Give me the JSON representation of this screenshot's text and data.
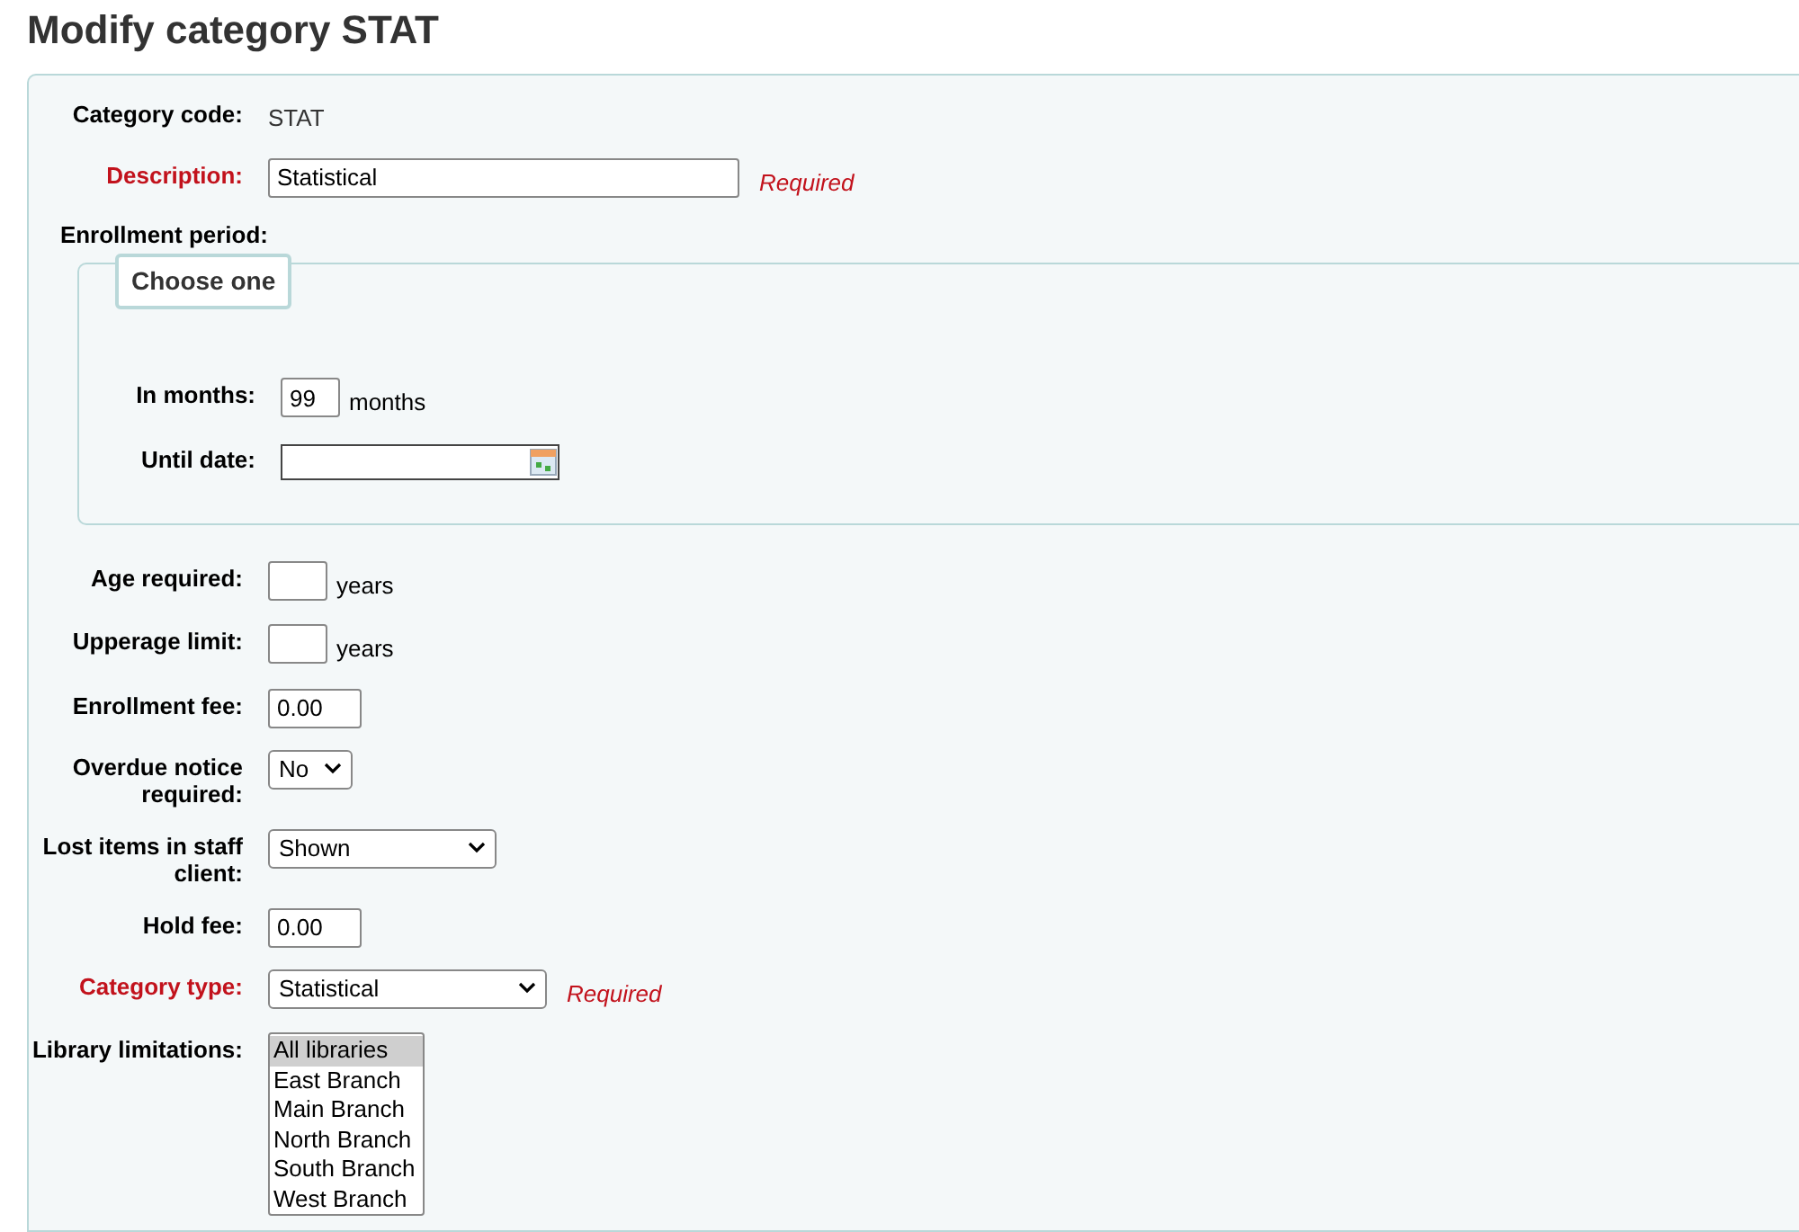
{
  "title": "Modify category STAT",
  "fields": [
    {
      "kind": "static",
      "label": "Category code:",
      "value": "STAT",
      "required": false
    },
    {
      "kind": "text",
      "label": "Description:",
      "value": "Statistical",
      "required": true,
      "note": "Required"
    },
    {
      "kind": "group",
      "label": "Enrollment period:",
      "required": false,
      "legend": "Choose one",
      "children": [
        {
          "kind": "count",
          "label": "In months:",
          "value": "99",
          "suffix": "months",
          "required": false
        },
        {
          "kind": "date",
          "label": "Until date:",
          "required": false
        }
      ]
    },
    {
      "kind": "count",
      "label": "Age required:",
      "suffix": "years",
      "required": false
    },
    {
      "kind": "count",
      "label": "Upperage limit:",
      "suffix": "years",
      "required": false
    },
    {
      "kind": "amount",
      "label": "Enrollment fee:",
      "value": "0.00",
      "required": false
    },
    {
      "kind": "select",
      "label": "Overdue notice required:",
      "value": "No",
      "required": false
    },
    {
      "kind": "select",
      "label": "Lost items in staff client:",
      "value": "Shown",
      "required": false
    },
    {
      "kind": "amount",
      "label": "Hold fee:",
      "value": "0.00",
      "required": false
    },
    {
      "kind": "select",
      "label": "Category type:",
      "value": "Statistical",
      "required": true,
      "note": "Required"
    },
    {
      "kind": "multiselect",
      "label": "Library limitations:",
      "required": false,
      "options": [
        {
          "label": "All libraries",
          "selected": true
        },
        {
          "label": "East Branch",
          "selected": false
        },
        {
          "label": "Main Branch",
          "selected": false
        },
        {
          "label": "North Branch",
          "selected": false
        },
        {
          "label": "South Branch",
          "selected": false
        },
        {
          "label": "West Branch",
          "selected": false
        }
      ]
    }
  ]
}
